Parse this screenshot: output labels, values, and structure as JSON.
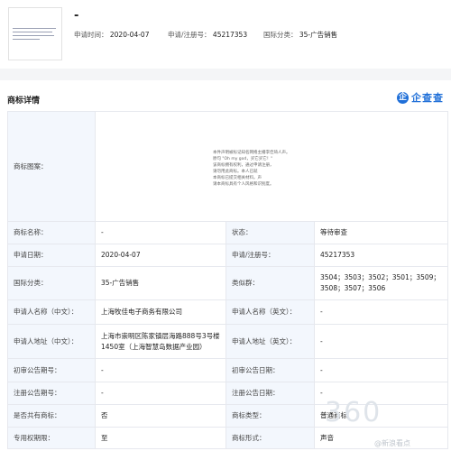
{
  "summary": {
    "title": "-",
    "apply_date_label": "申请时间：",
    "apply_date": "2020-04-07",
    "reg_no_label": "申请/注册号：",
    "reg_no": "45217353",
    "intl_class_label": "国际分类：",
    "intl_class": "35-广告销售"
  },
  "section": {
    "title": "商标详情"
  },
  "brand": {
    "icon_glyph": "企",
    "name": "企查查"
  },
  "image_text": [
    "本件声明被标记知名网络主播李佳琦人声。",
    "原句 \"Oh my god，买它买它！\"",
    "该商标拥有权利，通过申请注册，",
    "请勿用此商标。本人已就",
    "本商标已提交相关材料。声",
    "请本商标具有个人风格和识别度。"
  ],
  "rows": [
    {
      "k1": "商标图案：",
      "image": true
    },
    {
      "k1": "商标名称：",
      "v1": "-",
      "k2": "状态：",
      "v2": "等待审查"
    },
    {
      "k1": "申请日期：",
      "v1": "2020-04-07",
      "k2": "申请/注册号：",
      "v2": "45217353"
    },
    {
      "k1": "国际分类：",
      "v1": "35-广告销售",
      "k2": "类似群：",
      "v2": "3504；3503；3502；3501；3509；3508；3507；3506"
    },
    {
      "k1": "申请人名称（中文）：",
      "v1": "上海牧佳电子商务有限公司",
      "k2": "申请人名称（英文）：",
      "v2": "-"
    },
    {
      "k1": "申请人地址（中文）：",
      "v1": "上海市崇明区陈家镇层海路888号3号楼1450室（上海智慧岛数据产业园）",
      "k2": "申请人地址（英文）：",
      "v2": "-"
    },
    {
      "k1": "初审公告期号：",
      "v1": "-",
      "k2": "初审公告日期：",
      "v2": "-"
    },
    {
      "k1": "注册公告期号：",
      "v1": "-",
      "k2": "注册公告日期：",
      "v2": "-"
    },
    {
      "k1": "是否共有商标：",
      "v1": "否",
      "k2": "商标类型：",
      "v2": "普通商标"
    },
    {
      "k1": "专用权期限：",
      "v1": "至",
      "k2": "商标形式：",
      "v2": "声音"
    }
  ],
  "watermark": {
    "big": "360",
    "small": "@新浪看点"
  }
}
